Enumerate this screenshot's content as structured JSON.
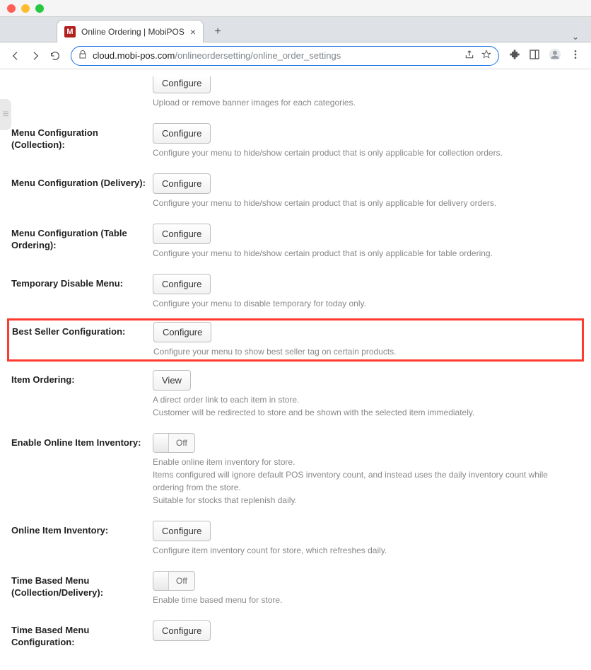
{
  "window": {
    "tab_title": "Online Ordering | MobiPOS",
    "favicon_letter": "M"
  },
  "address": {
    "host": "cloud.mobi-pos.com",
    "path": "/onlineordersetting/online_order_settings"
  },
  "partial_top": {
    "button": "Configure",
    "help": "Upload or remove banner images for each categories."
  },
  "rows": [
    {
      "label": "Menu Configuration (Collection):",
      "button": "Configure",
      "help": "Configure your menu to hide/show certain product that is only applicable for collection orders."
    },
    {
      "label": "Menu Configuration (Delivery):",
      "button": "Configure",
      "help": "Configure your menu to hide/show certain product that is only applicable for delivery orders."
    },
    {
      "label": "Menu Configuration (Table Ordering):",
      "button": "Configure",
      "help": "Configure your menu to hide/show certain product that is only applicable for table ordering."
    },
    {
      "label": "Temporary Disable Menu:",
      "button": "Configure",
      "help": "Configure your menu to disable temporary for today only."
    },
    {
      "label": "Best Seller Configuration:",
      "button": "Configure",
      "help": "Configure your menu to show best seller tag on certain products.",
      "highlight": true
    },
    {
      "label": "Item Ordering:",
      "button": "View",
      "help": "A direct order link to each item in store.\nCustomer will be redirected to store and be shown with the selected item immediately."
    },
    {
      "label": "Enable Online Item Inventory:",
      "toggle": "Off",
      "help": "Enable online item inventory for store.\nItems configured will ignore default POS inventory count, and instead uses the daily inventory count while ordering from the store.\nSuitable for stocks that replenish daily."
    },
    {
      "label": "Online Item Inventory:",
      "button": "Configure",
      "help": "Configure item inventory count for store, which refreshes daily."
    },
    {
      "label": "Time Based Menu (Collection/Delivery):",
      "toggle": "Off",
      "help": "Enable time based menu for store."
    },
    {
      "label": "Time Based Menu Configuration:",
      "button": "Configure",
      "help": ""
    }
  ]
}
